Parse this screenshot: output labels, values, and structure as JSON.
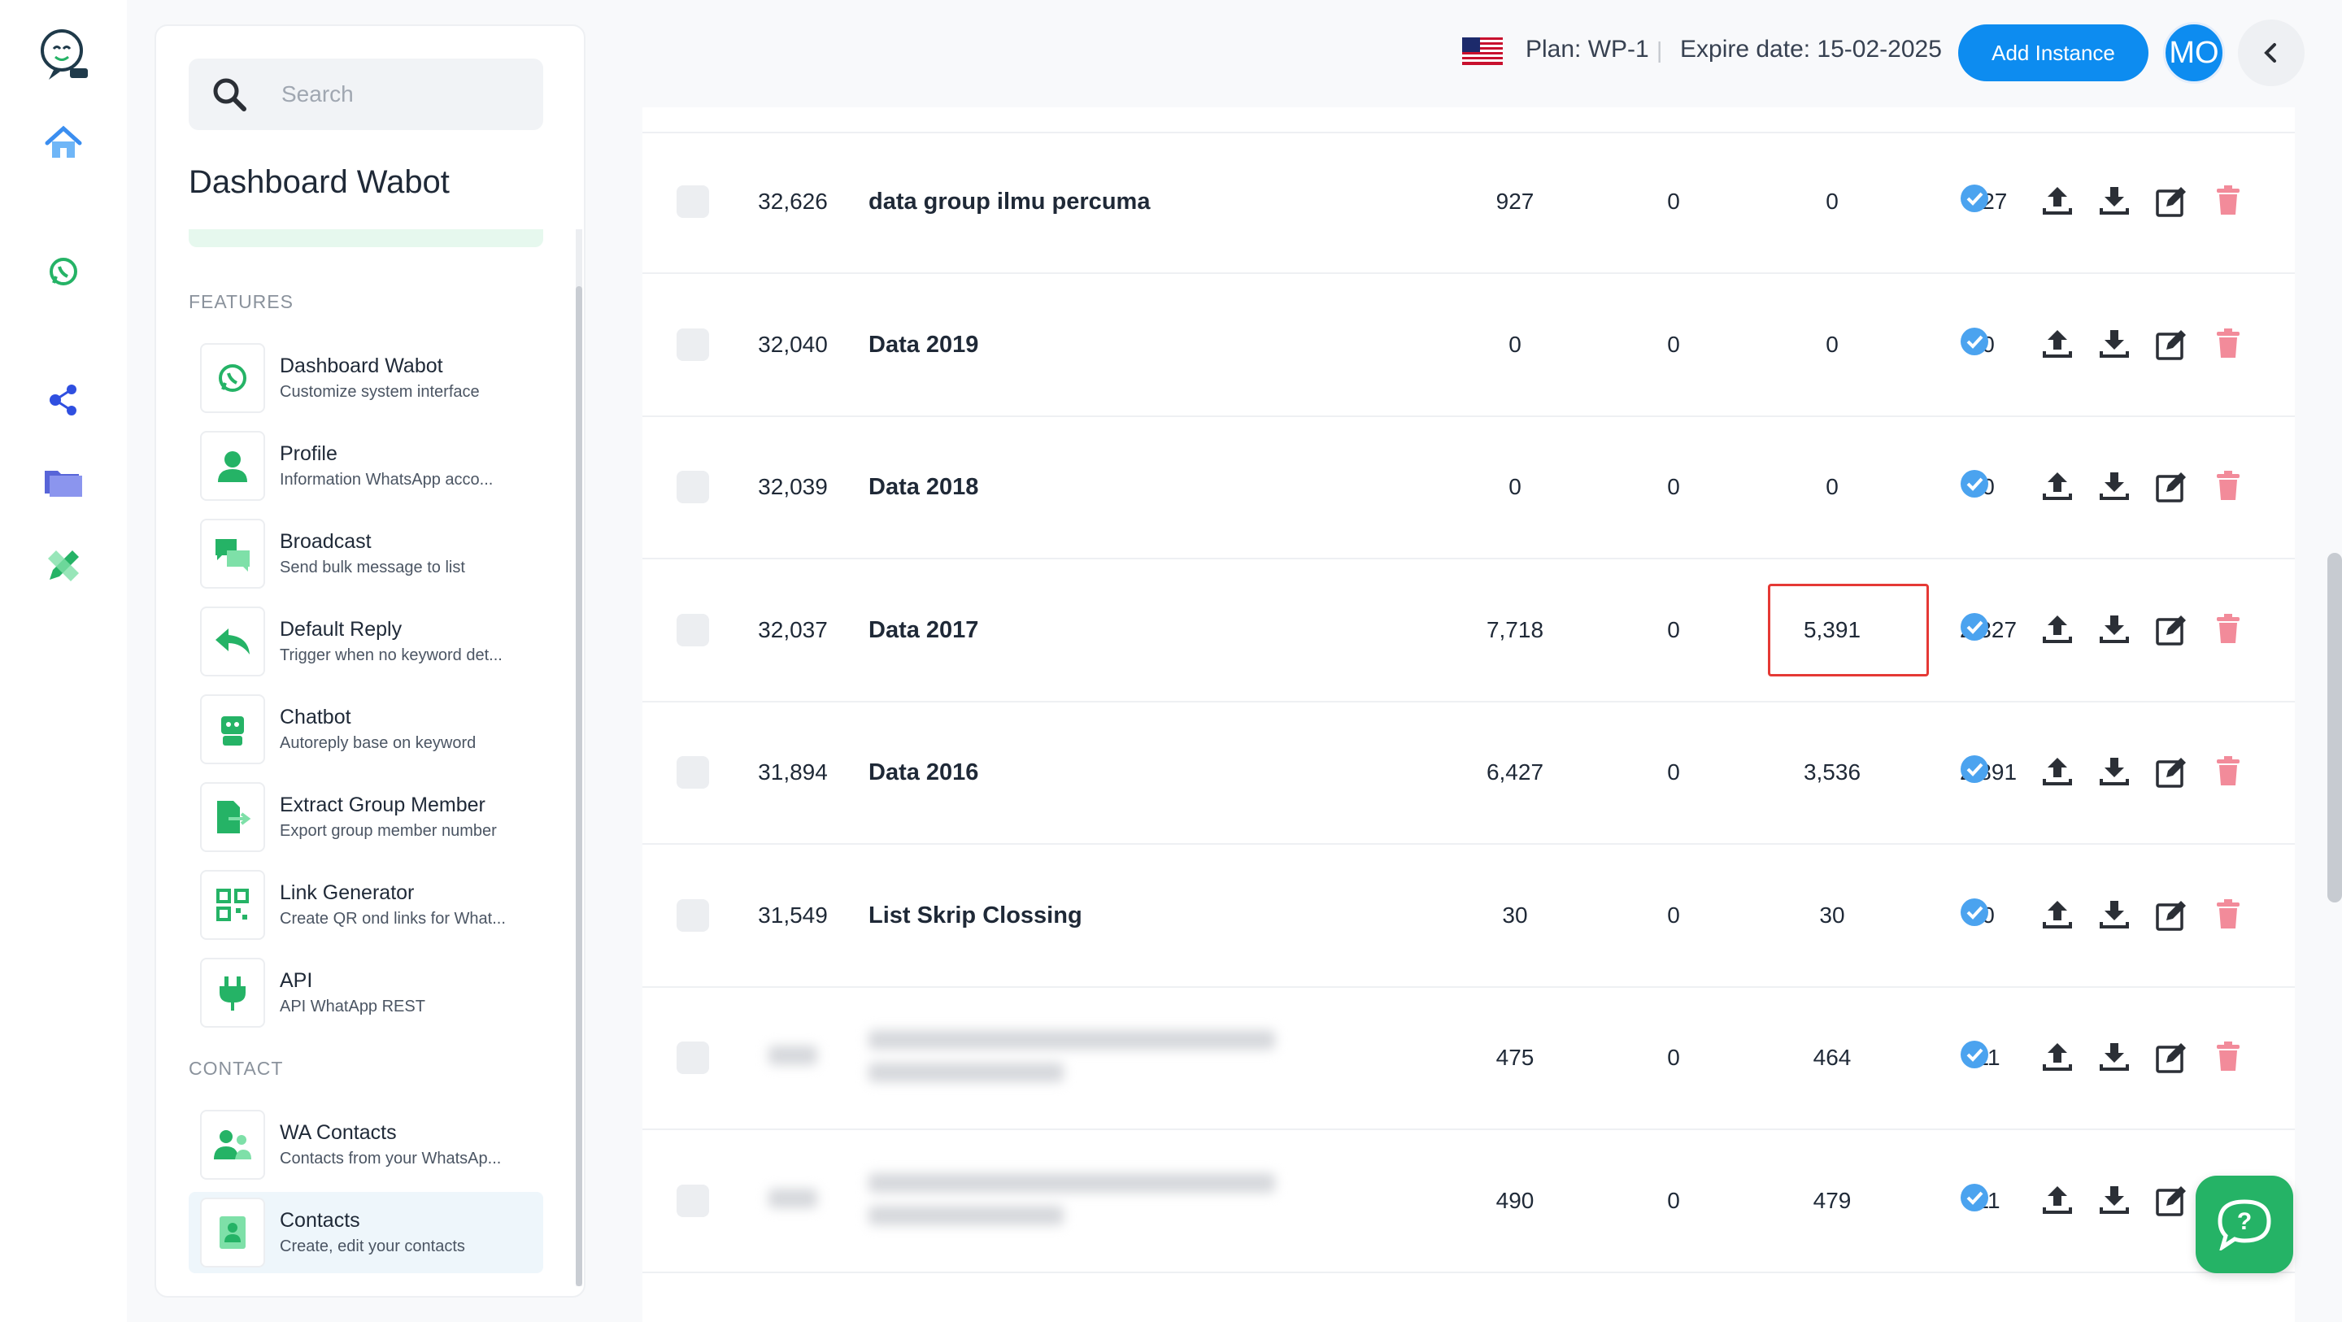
{
  "search": {
    "placeholder": "Search"
  },
  "panel": {
    "title": "Dashboard Wabot"
  },
  "sections": {
    "features": "FEATURES",
    "contact": "CONTACT"
  },
  "features": [
    {
      "title": "Dashboard Wabot",
      "subtitle": "Customize system interface",
      "icon": "whatsapp-icon"
    },
    {
      "title": "Profile",
      "subtitle": "Information WhatsApp acco...",
      "icon": "user-icon"
    },
    {
      "title": "Broadcast",
      "subtitle": "Send bulk message to list",
      "icon": "chat-bubbles-icon"
    },
    {
      "title": "Default Reply",
      "subtitle": "Trigger when no keyword det...",
      "icon": "reply-icon"
    },
    {
      "title": "Chatbot",
      "subtitle": "Autoreply base on keyword",
      "icon": "robot-icon"
    },
    {
      "title": "Extract Group Member",
      "subtitle": "Export group member number",
      "icon": "file-export-icon"
    },
    {
      "title": "Link Generator",
      "subtitle": "Create QR ond links for What...",
      "icon": "qr-icon"
    },
    {
      "title": "API",
      "subtitle": "API WhatApp REST",
      "icon": "plug-icon"
    }
  ],
  "contacts": [
    {
      "title": "WA Contacts",
      "subtitle": "Contacts from your WhatsAp...",
      "icon": "users-icon"
    },
    {
      "title": "Contacts",
      "subtitle": "Create, edit your contacts",
      "icon": "contact-card-icon"
    }
  ],
  "topbar": {
    "plan": "Plan: WP-1",
    "separator": "|",
    "expire": "Expire date: 15-02-2025",
    "add_instance": "Add Instance",
    "avatar": "MO"
  },
  "rows": [
    {
      "id": "32,626",
      "name": "data group ilmu percuma",
      "total": "927",
      "c2": "0",
      "c3": "0",
      "c4": "927"
    },
    {
      "id": "32,040",
      "name": "Data 2019",
      "total": "0",
      "c2": "0",
      "c3": "0",
      "c4": "0"
    },
    {
      "id": "32,039",
      "name": "Data 2018",
      "total": "0",
      "c2": "0",
      "c3": "0",
      "c4": "0"
    },
    {
      "id": "32,037",
      "name": "Data 2017",
      "total": "7,718",
      "c2": "0",
      "c3": "5,391",
      "c4": "2,327"
    },
    {
      "id": "31,894",
      "name": "Data 2016",
      "total": "6,427",
      "c2": "0",
      "c3": "3,536",
      "c4": "2,891"
    },
    {
      "id": "31,549",
      "name": "List Skrip Clossing",
      "total": "30",
      "c2": "0",
      "c3": "30",
      "c4": "0"
    },
    {
      "id": "",
      "name": "",
      "total": "475",
      "c2": "0",
      "c3": "464",
      "c4": "11"
    },
    {
      "id": "",
      "name": "",
      "total": "490",
      "c2": "0",
      "c3": "479",
      "c4": "11"
    }
  ],
  "colors": {
    "accent": "#0d8cf0",
    "brand_green": "#25b366",
    "highlight": "#e53935",
    "delete": "#f28b9a"
  }
}
